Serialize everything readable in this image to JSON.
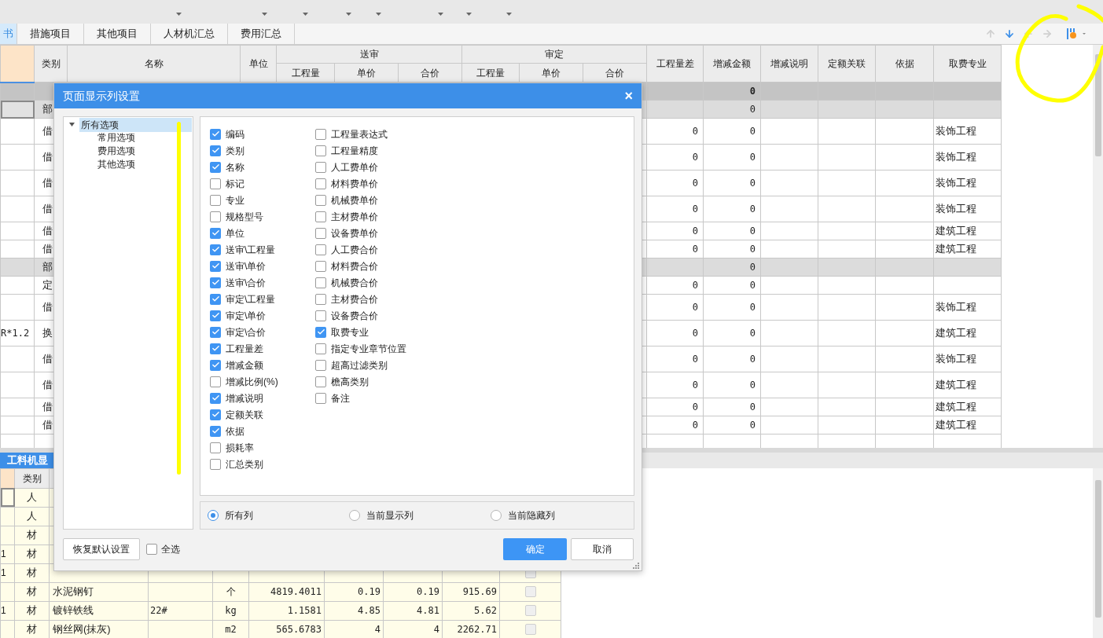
{
  "tabs": [
    {
      "label": "书",
      "selected": true
    },
    {
      "label": "措施项目",
      "selected": false
    },
    {
      "label": "其他项目",
      "selected": false
    },
    {
      "label": "人材机汇总",
      "selected": false
    },
    {
      "label": "费用汇总",
      "selected": false
    }
  ],
  "main_table": {
    "header": {
      "category": "类别",
      "name": "名称",
      "unit": "单位",
      "submitted": {
        "label": "送审",
        "sub": [
          "工程量",
          "单价",
          "合价"
        ]
      },
      "approved": {
        "label": "审定",
        "sub": [
          "工程量",
          "单价",
          "合价"
        ]
      },
      "tail": [
        "工程量差",
        "增减金额",
        "增减说明",
        "定额关联",
        "依据",
        "取费专业"
      ]
    },
    "rows": [
      {
        "kind": "total",
        "selected": false,
        "amount": "0"
      },
      {
        "kind": "section",
        "selected": true,
        "category": "部",
        "amount": "0"
      },
      {
        "kind": "item",
        "selected": false,
        "category": "借",
        "qty_diff": "0",
        "amount": "0",
        "fee_type": "装饰工程"
      },
      {
        "kind": "item",
        "selected": false,
        "category": "借",
        "qty_diff": "0",
        "amount": "0",
        "fee_type": "装饰工程"
      },
      {
        "kind": "item",
        "selected": false,
        "category": "借",
        "qty_diff": "0",
        "amount": "0",
        "fee_type": "装饰工程"
      },
      {
        "kind": "item",
        "selected": false,
        "category": "借",
        "qty_diff": "0",
        "amount": "0",
        "fee_type": "装饰工程"
      },
      {
        "kind": "item",
        "selected": false,
        "category": "借",
        "qty_diff": "0",
        "amount": "0",
        "fee_type": "建筑工程"
      },
      {
        "kind": "item",
        "selected": false,
        "category": "借",
        "qty_diff": "0",
        "amount": "0",
        "fee_type": "建筑工程"
      },
      {
        "kind": "section",
        "selected": false,
        "category": "部",
        "amount": "0"
      },
      {
        "kind": "item",
        "selected": false,
        "category": "定",
        "qty_diff": "0",
        "amount": "0"
      },
      {
        "kind": "item",
        "selected": false,
        "category": "借",
        "qty_diff": "0",
        "amount": "0",
        "fee_type": "装饰工程"
      },
      {
        "kind": "item",
        "selected": false,
        "code": "R*1.2",
        "category": "换",
        "qty_diff": "0",
        "amount": "0",
        "fee_type": "建筑工程"
      },
      {
        "kind": "item",
        "selected": false,
        "category": "借",
        "qty_diff": "0",
        "amount": "0",
        "fee_type": "装饰工程"
      },
      {
        "kind": "item",
        "selected": false,
        "category": "借",
        "qty_diff": "0",
        "amount": "0",
        "fee_type": "建筑工程"
      },
      {
        "kind": "item",
        "selected": false,
        "category": "借",
        "qty_diff": "0",
        "amount": "0",
        "fee_type": "建筑工程"
      },
      {
        "kind": "item",
        "selected": false,
        "category": "借",
        "qty_diff": "0",
        "amount": "0",
        "fee_type": "建筑工程"
      }
    ]
  },
  "bottom_pane": {
    "tab": "工料机显",
    "header": {
      "category": "类别"
    },
    "rows": [
      {
        "selected": true,
        "category": "人"
      },
      {
        "selected": false,
        "category": "人"
      },
      {
        "selected": false,
        "category": "材"
      },
      {
        "selected": false,
        "index": "1",
        "category": "材"
      },
      {
        "selected": false,
        "index": "1",
        "category": "材",
        "checked": false
      },
      {
        "selected": false,
        "category": "材",
        "name": "水泥钢钉",
        "unit": "个",
        "qty": "4819.4011",
        "price": "0.19",
        "price2": "0.19",
        "total": "915.69",
        "checked": false
      },
      {
        "selected": false,
        "index": "1",
        "category": "材",
        "name": "镀锌铁线",
        "spec": "22#",
        "unit": "kg",
        "qty": "1.1581",
        "price": "4.85",
        "price2": "4.81",
        "total": "5.62",
        "checked": false
      },
      {
        "selected": false,
        "category": "材",
        "name": "钢丝网(抹灰)",
        "unit": "m2",
        "qty": "565.6783",
        "price": "4",
        "price2": "4",
        "total": "2262.71",
        "checked": false
      }
    ]
  },
  "dialog": {
    "title": "页面显示列设置",
    "close": "×",
    "tree": [
      {
        "label": "所有选项",
        "selected": true,
        "expanded": true,
        "children": [
          {
            "label": "常用选项",
            "selected": false
          },
          {
            "label": "费用选项",
            "selected": false
          },
          {
            "label": "其他选项",
            "selected": false
          }
        ]
      }
    ],
    "option_columns": [
      [
        {
          "label": "编码",
          "checked": true
        },
        {
          "label": "类别",
          "checked": true
        },
        {
          "label": "名称",
          "checked": true
        },
        {
          "label": "标记",
          "checked": false
        },
        {
          "label": "专业",
          "checked": false
        },
        {
          "label": "规格型号",
          "checked": false
        },
        {
          "label": "单位",
          "checked": true
        },
        {
          "label": "送审\\工程量",
          "checked": true
        },
        {
          "label": "送审\\单价",
          "checked": true
        },
        {
          "label": "送审\\合价",
          "checked": true
        },
        {
          "label": "审定\\工程量",
          "checked": true
        },
        {
          "label": "审定\\单价",
          "checked": true
        },
        {
          "label": "审定\\合价",
          "checked": true
        },
        {
          "label": "工程量差",
          "checked": true
        },
        {
          "label": "增减金额",
          "checked": true
        },
        {
          "label": "增减比例(%)",
          "checked": false
        },
        {
          "label": "增减说明",
          "checked": true
        },
        {
          "label": "定额关联",
          "checked": true
        },
        {
          "label": "依据",
          "checked": true
        },
        {
          "label": "损耗率",
          "checked": false
        },
        {
          "label": "汇总类别",
          "checked": false
        }
      ],
      [
        {
          "label": "工程量表达式",
          "checked": false
        },
        {
          "label": "工程量精度",
          "checked": false
        },
        {
          "label": "人工费单价",
          "checked": false
        },
        {
          "label": "材料费单价",
          "checked": false
        },
        {
          "label": "机械费单价",
          "checked": false
        },
        {
          "label": "主材费单价",
          "checked": false
        },
        {
          "label": "设备费单价",
          "checked": false
        },
        {
          "label": "人工费合价",
          "checked": false
        },
        {
          "label": "材料费合价",
          "checked": false
        },
        {
          "label": "机械费合价",
          "checked": false
        },
        {
          "label": "主材费合价",
          "checked": false
        },
        {
          "label": "设备费合价",
          "checked": false
        },
        {
          "label": "取费专业",
          "checked": true
        },
        {
          "label": "指定专业章节位置",
          "checked": false
        },
        {
          "label": "超高过滤类别",
          "checked": false
        },
        {
          "label": "檐高类别",
          "checked": false
        },
        {
          "label": "备注",
          "checked": false
        }
      ]
    ],
    "radio_options": [
      {
        "label": "所有列",
        "selected": true
      },
      {
        "label": "当前显示列",
        "selected": false
      },
      {
        "label": "当前隐藏列",
        "selected": false
      }
    ],
    "restore_button": "恢复默认设置",
    "select_all": {
      "label": "全选",
      "checked": false
    },
    "ok_button": "确定",
    "cancel_button": "取消"
  }
}
